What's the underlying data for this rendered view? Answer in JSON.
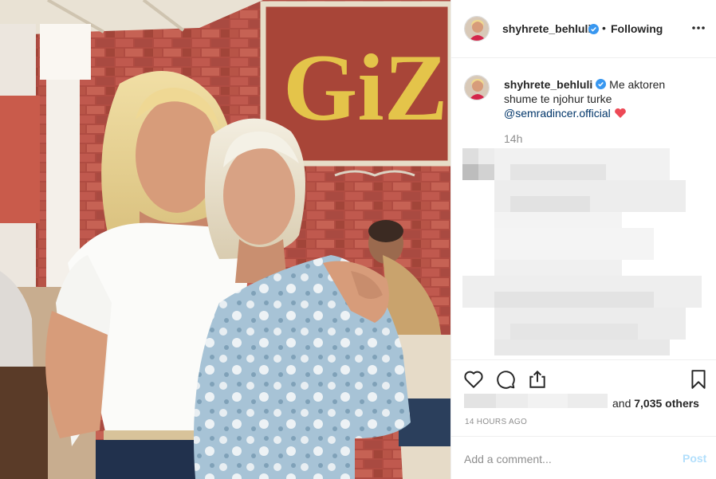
{
  "post": {
    "photo_sign_text": "GiZZ",
    "image_alt": "photo of two women posing in front of a brick wall"
  },
  "header": {
    "username": "shyhrete_behluli",
    "separator": "•",
    "follow_status": "Following",
    "more_icon": "more-dots-icon",
    "verified_icon": "verified-badge-icon"
  },
  "caption": {
    "username": "shyhrete_behluli",
    "text": "Me aktoren shume te njohur turke",
    "mention": "@semradincer.official",
    "emoji": "red-heart-icon",
    "time_ago": "14h"
  },
  "actions": {
    "like_icon": "heart-outline-icon",
    "comment_icon": "speech-bubble-icon",
    "share_icon": "share-icon",
    "save_icon": "bookmark-icon",
    "likes_connector": "and",
    "likes_count": "7,035 others",
    "timestamp": "14 HOURS AGO"
  },
  "comment": {
    "placeholder": "Add a comment...",
    "post_label": "Post"
  },
  "colors": {
    "verified": "#3897f0",
    "heart": "#ed4956",
    "mention": "#003569",
    "post_disabled": "#b2dffc",
    "brick": "#b9544a"
  }
}
